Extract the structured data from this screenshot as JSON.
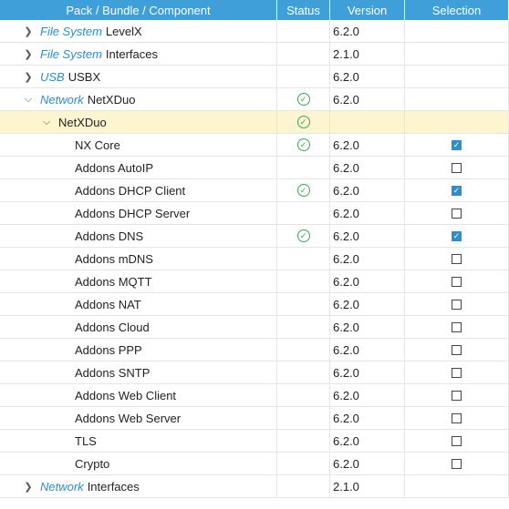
{
  "header": {
    "col_pack": "Pack / Bundle / Component",
    "col_status": "Status",
    "col_version": "Version",
    "col_selection": "Selection"
  },
  "rows": [
    {
      "cat": "File System",
      "name": "LevelX",
      "version": "6.2.0"
    },
    {
      "cat": "File System",
      "name": "Interfaces",
      "version": "2.1.0"
    },
    {
      "cat": "USB",
      "name": "USBX",
      "version": "6.2.0"
    },
    {
      "cat": "Network",
      "name": "NetXDuo",
      "version": "6.2.0"
    },
    {
      "name": "NetXDuo"
    },
    {
      "name": "NX Core",
      "version": "6.2.0"
    },
    {
      "name": "Addons AutoIP",
      "version": "6.2.0"
    },
    {
      "name": "Addons DHCP Client",
      "version": "6.2.0"
    },
    {
      "name": "Addons DHCP Server",
      "version": "6.2.0"
    },
    {
      "name": "Addons DNS",
      "version": "6.2.0"
    },
    {
      "name": "Addons mDNS",
      "version": "6.2.0"
    },
    {
      "name": "Addons MQTT",
      "version": "6.2.0"
    },
    {
      "name": "Addons NAT",
      "version": "6.2.0"
    },
    {
      "name": "Addons Cloud",
      "version": "6.2.0"
    },
    {
      "name": "Addons PPP",
      "version": "6.2.0"
    },
    {
      "name": "Addons SNTP",
      "version": "6.2.0"
    },
    {
      "name": "Addons Web Client",
      "version": "6.2.0"
    },
    {
      "name": "Addons Web Server",
      "version": "6.2.0"
    },
    {
      "name": "TLS",
      "version": "6.2.0"
    },
    {
      "name": "Crypto",
      "version": "6.2.0"
    },
    {
      "cat": "Network",
      "name": "Interfaces",
      "version": "2.1.0"
    }
  ],
  "icons": {
    "expand": "chevron-right-icon",
    "collapse": "chevron-down-icon",
    "status_ok": "check-circle-icon"
  },
  "colors": {
    "header": "#3f9fd8",
    "category": "#2a8ed0",
    "selected_row": "#fdf4d0",
    "ok": "#3aa757"
  }
}
